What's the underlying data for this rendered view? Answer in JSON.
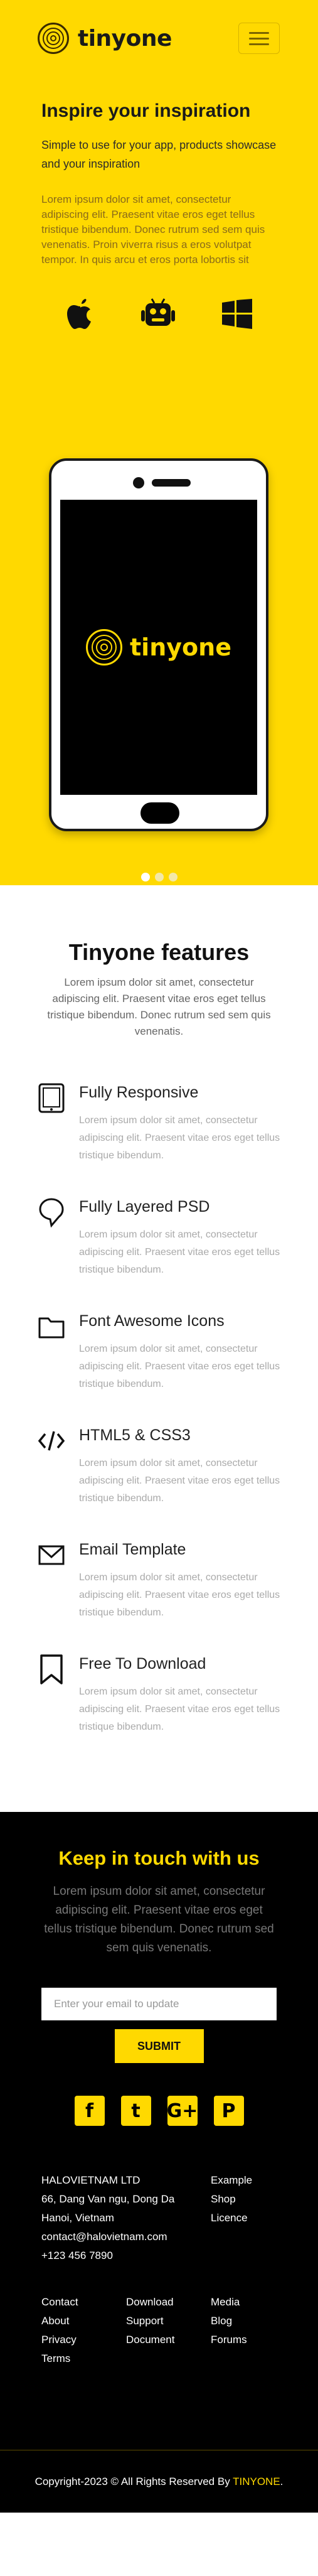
{
  "header": {
    "logo_text": "tinyone",
    "menu_icon": "hamburger-icon"
  },
  "hero": {
    "title": "Inspire your inspiration",
    "subtitle": "Simple to use for your app, products showcase and your inspiration",
    "lorem": "Lorem ipsum dolor sit amet, consectetur adipiscing elit. Praesent vitae eros eget tellus tristique bibendum. Donec rutrum sed sem quis venenatis. Proin viverra risus a eros volutpat tempor. In quis arcu et eros porta lobortis sit",
    "platform_icons": [
      "apple-icon",
      "android-icon",
      "windows-icon"
    ],
    "phone_screen_logo": "tinyone",
    "slider_dots": 3,
    "active_dot": 0
  },
  "features": {
    "title": "Tinyone features",
    "intro": "Lorem ipsum dolor sit amet, consectetur adipiscing elit. Praesent vitae eros eget tellus tristique bibendum. Donec rutrum sed sem quis venenatis.",
    "items": [
      {
        "title": "Fully Responsive",
        "text": "Lorem ipsum dolor sit amet, consectetur adipiscing elit. Praesent vitae eros eget tellus tristique bibendum.",
        "icon": "tablet-icon"
      },
      {
        "title": "Fully Layered PSD",
        "text": "Lorem ipsum dolor sit amet, consectetur adipiscing elit. Praesent vitae eros eget tellus tristique bibendum.",
        "icon": "layer-icon"
      },
      {
        "title": "Font Awesome Icons",
        "text": "Lorem ipsum dolor sit amet, consectetur adipiscing elit. Praesent vitae eros eget tellus tristique bibendum.",
        "icon": "folder-icon"
      },
      {
        "title": "HTML5 & CSS3",
        "text": "Lorem ipsum dolor sit amet, consectetur adipiscing elit. Praesent vitae eros eget tellus tristique bibendum.",
        "icon": "code-icon"
      },
      {
        "title": "Email Template",
        "text": "Lorem ipsum dolor sit amet, consectetur adipiscing elit. Praesent vitae eros eget tellus tristique bibendum.",
        "icon": "envelope-icon"
      },
      {
        "title": "Free To Download",
        "text": "Lorem ipsum dolor sit amet, consectetur adipiscing elit. Praesent vitae eros eget tellus tristique bibendum.",
        "icon": "bookmark-icon"
      }
    ]
  },
  "contact": {
    "title": "Keep in touch with us",
    "intro": "Lorem ipsum dolor sit amet, consectetur adipiscing elit. Praesent vitae eros eget tellus tristique bibendum. Donec rutrum sed sem quis venenatis.",
    "email_placeholder": "Enter your email to update",
    "submit_label": "SUBMIT",
    "socials": [
      {
        "icon": "facebook-icon",
        "glyph": "f"
      },
      {
        "icon": "twitter-icon",
        "glyph": "t"
      },
      {
        "icon": "google-plus-icon",
        "glyph": "G+"
      },
      {
        "icon": "pinterest-icon",
        "glyph": "P"
      }
    ],
    "address_lines": [
      "HALOVIETNAM LTD",
      "66, Dang Van ngu, Dong Da",
      "Hanoi, Vietnam",
      "contact@halovietnam.com",
      "+123 456 7890"
    ],
    "right_links": [
      "Example",
      "Shop",
      "Licence"
    ],
    "link_columns": [
      [
        "Contact",
        "About",
        "Privacy",
        "Terms"
      ],
      [
        "Download",
        "Support",
        "Document"
      ],
      [
        "Media",
        "Blog",
        "Forums"
      ]
    ]
  },
  "footer": {
    "copyright_prefix": "Copyright-2023 © All Rights Reserved By ",
    "brand": "TINYONE",
    "suffix": "."
  },
  "colors": {
    "accent": "#ffd900",
    "dark": "#000000"
  }
}
